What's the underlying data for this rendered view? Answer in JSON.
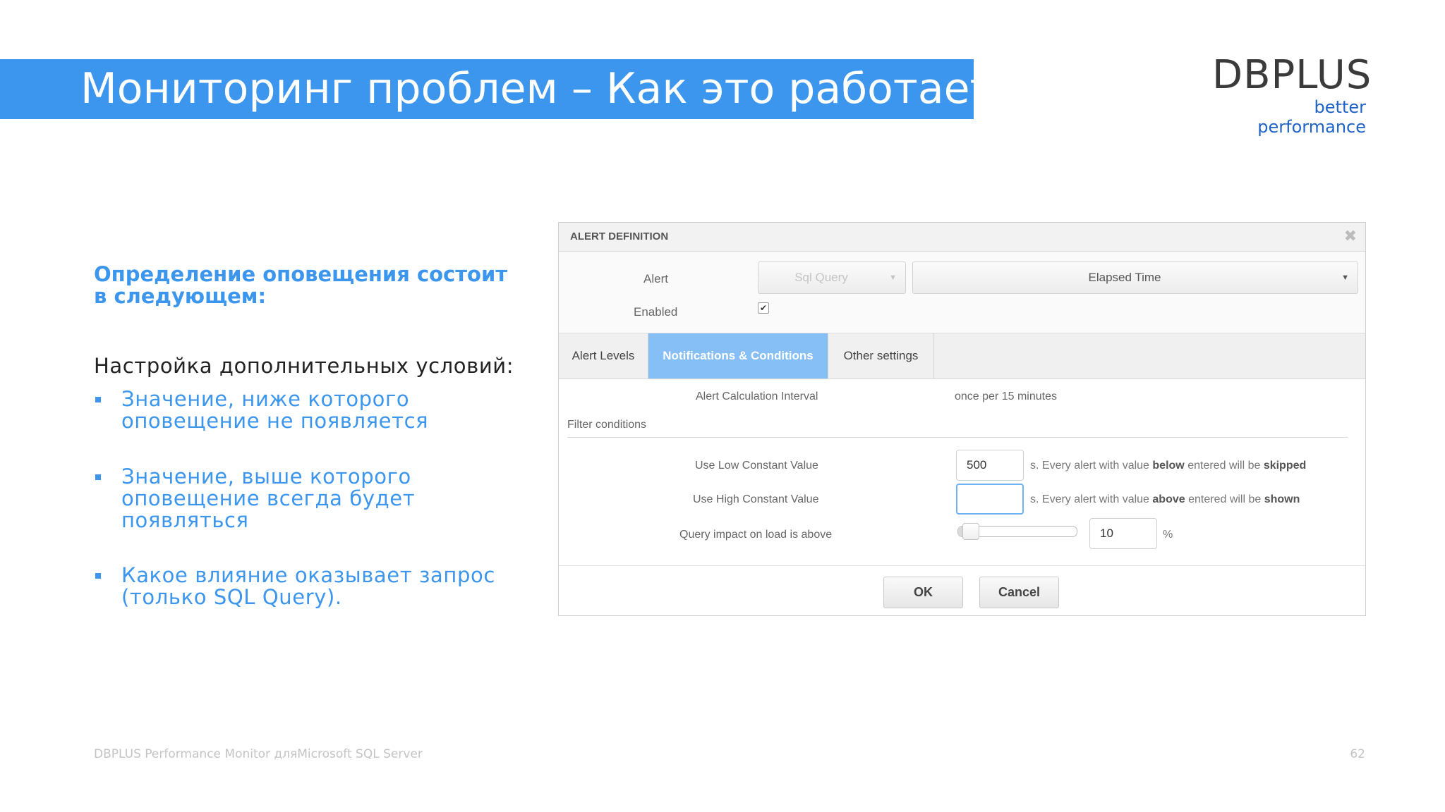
{
  "slide": {
    "title": "Мониторинг проблем – Как это работает?",
    "logo": {
      "name": "DBPLUS",
      "tagline": "better performance"
    },
    "lead": "Определение оповещения состоит в следующем:",
    "subhead": "Настройка дополнительных условий:",
    "bullets": [
      "Значение, ниже которого оповещение не появляется",
      "Значение, выше которого оповещение всегда будет появляться",
      "Какое влияние оказывает запрос (только SQL Query)."
    ],
    "footer": "DBPLUS Performance Monitor дляMicrosoft SQL Server",
    "page_number": "62"
  },
  "dialog": {
    "title": "ALERT DEFINITION",
    "close_icon": "close-icon",
    "alert_label": "Alert",
    "alert_type": "Sql Query",
    "alert_metric": "Elapsed Time",
    "enabled_label": "Enabled",
    "enabled_checked": true,
    "check_mark": "✔",
    "caret": "▼",
    "tabs": [
      {
        "label": "Alert Levels",
        "active": false
      },
      {
        "label": "Notifications & Conditions",
        "active": true
      },
      {
        "label": "Other settings",
        "active": false
      }
    ],
    "calc_interval_label": "Alert Calculation Interval",
    "calc_interval_value": "once per 15 minutes",
    "filter_conditions_label": "Filter conditions",
    "low_label": "Use Low Constant Value",
    "low_value": "500",
    "low_hint_pre": "s.  Every alert with value ",
    "low_hint_bold1": "below",
    "low_hint_mid": " entered will be ",
    "low_hint_bold2": "skipped",
    "high_label": "Use High Constant Value",
    "high_value": "",
    "high_hint_pre": "s.  Every alert with value ",
    "high_hint_bold1": "above",
    "high_hint_mid": " entered will be ",
    "high_hint_bold2": "shown",
    "impact_label": "Query impact on load is above",
    "impact_value": "10",
    "impact_unit": "%",
    "impact_slider_fraction": 0.1,
    "ok_label": "OK",
    "cancel_label": "Cancel"
  }
}
